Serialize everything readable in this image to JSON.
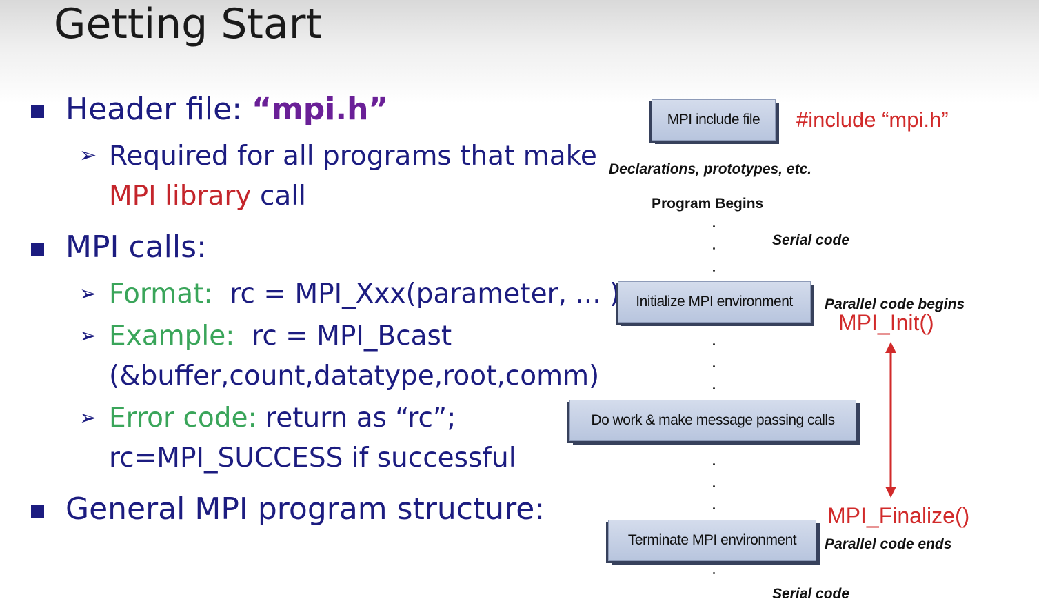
{
  "title": "Getting Start",
  "bullets": {
    "header": {
      "label": "Header file:",
      "value": "“mpi.h”",
      "sub_line1": "Required for all programs that make",
      "sub_line2_red": "MPI library",
      "sub_line2_rest": " call"
    },
    "calls": {
      "label": "MPI calls:",
      "format_label": "Format:",
      "format_text": "  rc = MPI_Xxx(parameter, ... )",
      "example_label": "Example:",
      "example_text": "  rc = MPI_Bcast",
      "example_line2": "(&buffer,count,datatype,root,comm)",
      "error_label": "Error code:",
      "error_text": " return as “rc”;",
      "error_line2": "rc=MPI_SUCCESS if successful"
    },
    "structure": {
      "label": "General MPI program structure:"
    }
  },
  "diagram": {
    "include_box": "MPI include file",
    "include_code": "#include “mpi.h”",
    "declarations": "Declarations, prototypes, etc.",
    "program_begins": "Program Begins",
    "serial_code_top": "Serial code",
    "init_box": "Initialize MPI environment",
    "parallel_begins": "Parallel code begins",
    "mpi_init": "MPI_Init()",
    "work_box": "Do work & make message passing calls",
    "mpi_finalize": "MPI_Finalize()",
    "terminate_box": "Terminate MPI environment",
    "parallel_ends": "Parallel code ends",
    "serial_code_bottom": "Serial code"
  },
  "colors": {
    "bullet_text": "#1c1c80",
    "keyword_purple": "#6a2097",
    "accent_red": "#c4252b",
    "accent_green": "#3aa55a"
  }
}
